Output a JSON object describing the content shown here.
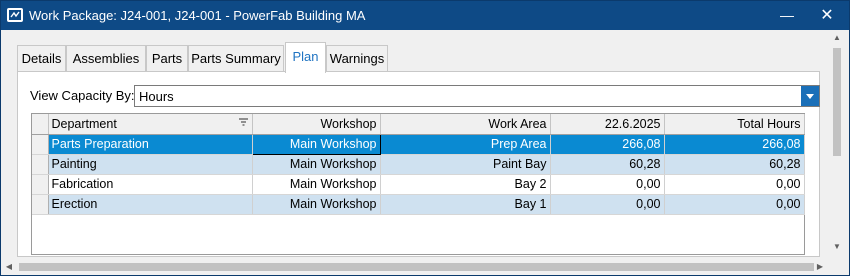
{
  "window": {
    "title": "Work Package: J24-001, J24-001 - PowerFab Building MA",
    "app_icon": "work-package-icon",
    "minimize_glyph": "—",
    "close_glyph": "✕"
  },
  "tabs": [
    {
      "label": "Details",
      "active": false
    },
    {
      "label": "Assemblies",
      "active": false
    },
    {
      "label": "Parts",
      "active": false
    },
    {
      "label": "Parts Summary",
      "active": false
    },
    {
      "label": "Plan",
      "active": true
    },
    {
      "label": "Warnings",
      "active": false
    }
  ],
  "view_capacity": {
    "label": "View Capacity By:",
    "value": "Hours"
  },
  "grid": {
    "columns": [
      "Department",
      "Workshop",
      "Work Area",
      "22.6.2025",
      "Total Hours"
    ],
    "rows": [
      {
        "department": "Parts Preparation",
        "workshop": "Main Workshop",
        "work_area": "Prep Area",
        "date_hours": "266,08",
        "total_hours": "266,08",
        "selected": true
      },
      {
        "department": "Painting",
        "workshop": "Main Workshop",
        "work_area": "Paint Bay",
        "date_hours": "60,28",
        "total_hours": "60,28",
        "selected": false
      },
      {
        "department": "Fabrication",
        "workshop": "Main Workshop",
        "work_area": "Bay 2",
        "date_hours": "0,00",
        "total_hours": "0,00",
        "selected": false
      },
      {
        "department": "Erection",
        "workshop": "Main Workshop",
        "work_area": "Bay 1",
        "date_hours": "0,00",
        "total_hours": "0,00",
        "selected": false
      }
    ]
  },
  "colors": {
    "titlebar": "#0e4a86",
    "selection": "#0a8ad2",
    "alt_row": "#cfe1f0",
    "active_tab_text": "#1e73c2"
  }
}
